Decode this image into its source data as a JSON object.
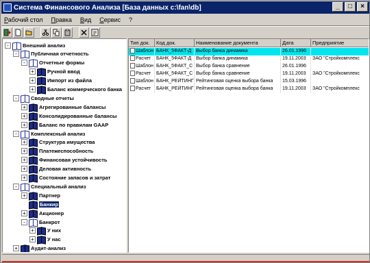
{
  "window": {
    "title": "Система Финансового Анализа [База данных c:\\fan\\db]"
  },
  "menu": [
    "Рабочий стол",
    "Правка",
    "Вид",
    "Сервис",
    "?"
  ],
  "toolbar": {
    "icons": [
      "exit-icon",
      "new-icon",
      "open-icon",
      "cut-icon",
      "copy-icon",
      "paste-icon",
      "delete-icon",
      "properties-icon"
    ]
  },
  "tree": {
    "nodes": [
      {
        "label": "Внешний анализ",
        "level": 0,
        "toggle": "-",
        "open": true
      },
      {
        "label": "Публичная отчетность",
        "level": 1,
        "toggle": "-",
        "open": true
      },
      {
        "label": "Отчетные формы",
        "level": 2,
        "toggle": "-",
        "open": true
      },
      {
        "label": "Ручной ввод",
        "level": 3,
        "toggle": "+",
        "open": false
      },
      {
        "label": "Импорт из файла",
        "level": 3,
        "toggle": "+",
        "open": false
      },
      {
        "label": "Баланс коммерческого банка",
        "level": 3,
        "toggle": "+",
        "open": false
      },
      {
        "label": "Сводные отчеты",
        "level": 1,
        "toggle": "-",
        "open": true
      },
      {
        "label": "Агрегированные балансы",
        "level": 2,
        "toggle": "+",
        "open": false
      },
      {
        "label": "Консолидированные балансы",
        "level": 2,
        "toggle": "+",
        "open": false
      },
      {
        "label": "Баланс по правилам GAAP",
        "level": 2,
        "toggle": "+",
        "open": false
      },
      {
        "label": "Комплексный анализ",
        "level": 1,
        "toggle": "-",
        "open": true
      },
      {
        "label": "Структура имущества",
        "level": 2,
        "toggle": "+",
        "open": false
      },
      {
        "label": "Платежеспособность",
        "level": 2,
        "toggle": "+",
        "open": false
      },
      {
        "label": "Финансовая устойчивость",
        "level": 2,
        "toggle": "+",
        "open": false
      },
      {
        "label": "Деловая активность",
        "level": 2,
        "toggle": "+",
        "open": false
      },
      {
        "label": "Состояние запасов и затрат",
        "level": 2,
        "toggle": "+",
        "open": false
      },
      {
        "label": "Специальный анализ",
        "level": 1,
        "toggle": "-",
        "open": true
      },
      {
        "label": "Партнер",
        "level": 2,
        "toggle": "+",
        "open": false
      },
      {
        "label": "Банкир",
        "level": 2,
        "toggle": "",
        "open": false,
        "selected": true
      },
      {
        "label": "Акционер",
        "level": 2,
        "toggle": "+",
        "open": false
      },
      {
        "label": "Банкрот",
        "level": 2,
        "toggle": "-",
        "open": true
      },
      {
        "label": "У них",
        "level": 3,
        "toggle": "+",
        "open": false
      },
      {
        "label": "У нас",
        "level": 3,
        "toggle": "+",
        "open": false
      },
      {
        "label": "Аудит-анализ",
        "level": 1,
        "toggle": "+",
        "open": false
      }
    ]
  },
  "grid": {
    "columns": [
      "Тип док.",
      "Код док.",
      "Наименование документа",
      "Дата",
      "Предприятие"
    ],
    "rows": [
      {
        "type": "Шаблон",
        "code": "БАНК_5ФАКТ-Д",
        "name": "Выбор банка динамика",
        "date": "26.01.1996",
        "company": "",
        "selected": true
      },
      {
        "type": "Расчет",
        "code": "БАНК_5ФАКТ-Д",
        "name": "Выбор банка динамика",
        "date": "19.11.2003",
        "company": "ЗАО \"Стройкомплекс",
        "selected": false
      },
      {
        "type": "Шаблон",
        "code": "БАНК_5ФАКТ_С",
        "name": "Выбор банка сравнение",
        "date": "26.01.1996",
        "company": "",
        "selected": false
      },
      {
        "type": "Расчет",
        "code": "БАНК_5ФАКТ_С",
        "name": "Выбор банка сравнение",
        "date": "19.11.2003",
        "company": "ЗАО \"Стройкомплекс",
        "selected": false
      },
      {
        "type": "Шаблон",
        "code": "БАНК_РЕЙТИНГ",
        "name": "Рейтинговая оценка выбора банка",
        "date": "15.03.1996",
        "company": "",
        "selected": false
      },
      {
        "type": "Расчет",
        "code": "БАНК_РЕЙТИНГ",
        "name": "Рейтинговая оценка выбора банка",
        "date": "19.11.2003",
        "company": "ЗАО \"Стройкомплекс",
        "selected": false
      }
    ]
  }
}
